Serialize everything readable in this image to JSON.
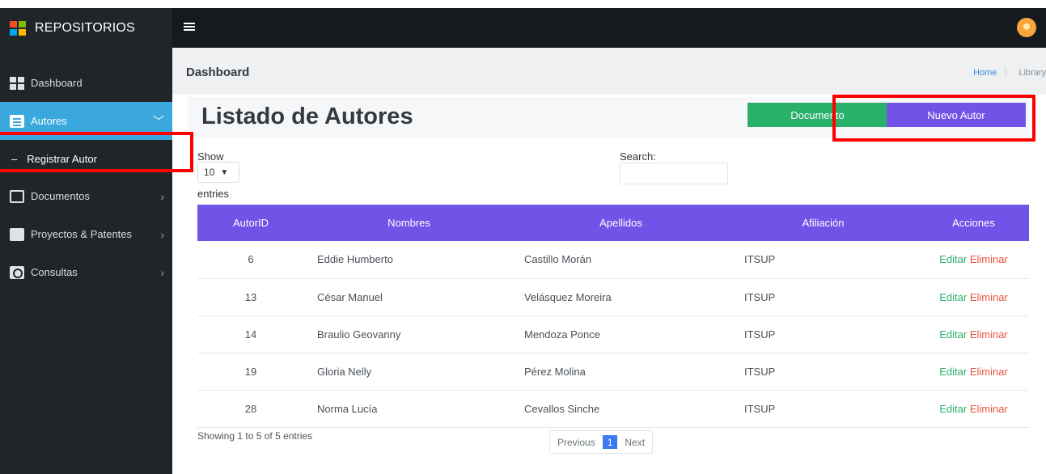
{
  "brand": {
    "name": "REPOSITORIOS"
  },
  "sidebar": {
    "items": [
      {
        "label": "Dashboard",
        "icon": "dashboard-icon"
      },
      {
        "label": "Autores",
        "icon": "list-icon",
        "active": true
      },
      {
        "label": "Registrar Autor",
        "sub": true
      },
      {
        "label": "Documentos",
        "icon": "document-icon"
      },
      {
        "label": "Proyectos & Patentes",
        "icon": "folder-icon"
      },
      {
        "label": "Consultas",
        "icon": "search-doc-icon"
      }
    ]
  },
  "header": {
    "title": "Dashboard",
    "breadcrumb": [
      "Home",
      "Library"
    ]
  },
  "main": {
    "title": "Listado de Autores",
    "doc_button": "Documento",
    "new_button": "Nuevo Autor",
    "show_label": "Show",
    "length_value": "10",
    "entries_label": "entries",
    "search_label": "Search:",
    "search_value": ""
  },
  "table": {
    "headers": [
      "AutorID",
      "Nombres",
      "Apellidos",
      "Afiliación",
      "Acciones"
    ],
    "rows": [
      {
        "id": "6",
        "nombres": "Eddie Humberto",
        "apellidos": "Castillo Morán",
        "afiliacion": "ITSUP",
        "edit": "Editar",
        "delete": "Eliminar"
      },
      {
        "id": "13",
        "nombres": "César Manuel",
        "apellidos": "Velásquez Moreira",
        "afiliacion": "ITSUP",
        "edit": "Editar",
        "delete": "Eliminar"
      },
      {
        "id": "14",
        "nombres": "Braulio Geovanny",
        "apellidos": "Mendoza Ponce",
        "afiliacion": "ITSUP",
        "edit": "Editar",
        "delete": "Eliminar"
      },
      {
        "id": "19",
        "nombres": "Gloria Nelly",
        "apellidos": "Pérez Molina",
        "afiliacion": "ITSUP",
        "edit": "Editar",
        "delete": "Eliminar"
      },
      {
        "id": "28",
        "nombres": "Norma Lucía",
        "apellidos": "Cevallos Sinche",
        "afiliacion": "ITSUP",
        "edit": "Editar",
        "delete": "Eliminar"
      }
    ],
    "info": "Showing 1 to 5 of 5 entries",
    "pagination": {
      "previous": "Previous",
      "current": "1",
      "next": "Next"
    }
  },
  "colors": {
    "sidebar_bg": "#212529",
    "sidebar_active": "#3aa8dd",
    "primary_purple": "#7153e8",
    "success_green": "#29b06a",
    "danger": "#e8563f",
    "highlight": "#ff0000"
  }
}
